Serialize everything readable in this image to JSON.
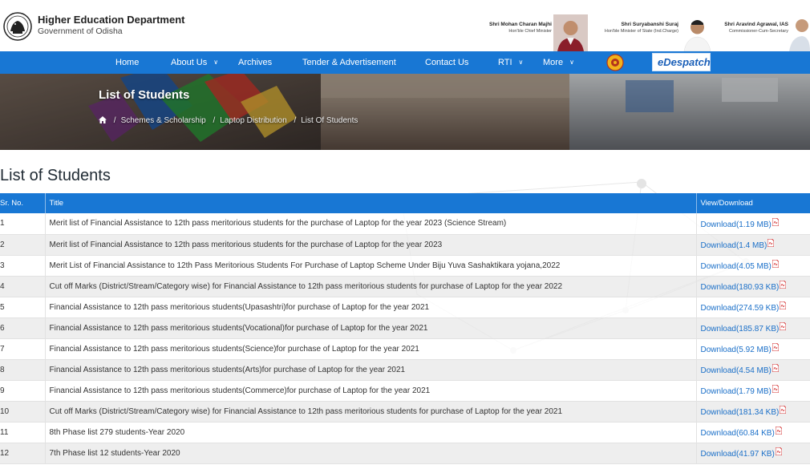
{
  "header": {
    "org_title": "Higher Education Department",
    "org_subtitle": "Government of Odisha",
    "logo_icon": "odisha-emblem-icon",
    "dignitaries": [
      {
        "name": "Shri Mohan Charan Majhi",
        "role": "Hon'ble Chief Minister"
      },
      {
        "name": "Shri Suryabanshi Suraj",
        "role": "Hon'ble Minister of State (Ind.Charge)"
      },
      {
        "name": "Shri Aravind Agrawal, IAS",
        "role": "Commissioner-Cum-Secretary"
      }
    ]
  },
  "nav": {
    "items": [
      {
        "label": "Home",
        "has_dropdown": false
      },
      {
        "label": "About Us",
        "has_dropdown": true
      },
      {
        "label": "Archives",
        "has_dropdown": false
      },
      {
        "label": "Tender & Advertisement",
        "has_dropdown": false
      },
      {
        "label": "Contact Us",
        "has_dropdown": false
      },
      {
        "label": "RTI",
        "has_dropdown": true
      },
      {
        "label": "More",
        "has_dropdown": true
      }
    ],
    "despatch_label": "eDespatch",
    "accent_color": "#1877d4"
  },
  "banner": {
    "title": "List of Students",
    "breadcrumb": [
      "Schemes & Scholarship",
      "Laptop Distribution",
      "List Of Students"
    ]
  },
  "main": {
    "heading": "List of Students",
    "table": {
      "columns": [
        "Sr. No.",
        "Title",
        "View/Download"
      ],
      "rows": [
        {
          "sr": "1",
          "title": "Merit list of Financial Assistance to 12th pass meritorious students for the purchase of Laptop for the year 2023 (Science Stream)",
          "link": "Download(1.19 MB)"
        },
        {
          "sr": "2",
          "title": "Merit list of Financial Assistance to 12th pass meritorious students for the purchase of Laptop for the year 2023",
          "link": "Download(1.4 MB)"
        },
        {
          "sr": "3",
          "title": "Merit List of Financial Assistance to 12th Pass Meritorious Students For Purchase of Laptop Scheme Under Biju Yuva Sashaktikara yojana,2022",
          "link": "Download(4.05 MB)"
        },
        {
          "sr": "4",
          "title": "Cut off Marks (District/Stream/Category wise) for Financial Assistance to 12th pass meritorious students for purchase of Laptop for the year 2022",
          "link": "Download(180.93 KB)"
        },
        {
          "sr": "5",
          "title": "Financial Assistance to 12th pass meritorious students(Upasashtri)for purchase of Laptop for the year 2021",
          "link": "Download(274.59 KB)"
        },
        {
          "sr": "6",
          "title": "Financial Assistance to 12th pass meritorious students(Vocational)for purchase of Laptop for the year 2021",
          "link": "Download(185.87 KB)"
        },
        {
          "sr": "7",
          "title": "Financial Assistance to 12th pass meritorious students(Science)for purchase of Laptop for the year 2021",
          "link": "Download(5.92 MB)"
        },
        {
          "sr": "8",
          "title": "Financial Assistance to 12th pass meritorious students(Arts)for purchase of Laptop for the year 2021",
          "link": "Download(4.54 MB)"
        },
        {
          "sr": "9",
          "title": "Financial Assistance to 12th pass meritorious students(Commerce)for purchase of Laptop for the year 2021",
          "link": "Download(1.79 MB)"
        },
        {
          "sr": "10",
          "title": "Cut off Marks (District/Stream/Category wise) for Financial Assistance to 12th pass meritorious students for purchase of Laptop for the year 2021",
          "link": "Download(181.34 KB)"
        },
        {
          "sr": "11",
          "title": "8th Phase list 279 students-Year 2020",
          "link": "Download(60.84 KB)"
        },
        {
          "sr": "12",
          "title": "7th Phase list 12 students-Year 2020",
          "link": "Download(41.97 KB)"
        }
      ]
    }
  }
}
